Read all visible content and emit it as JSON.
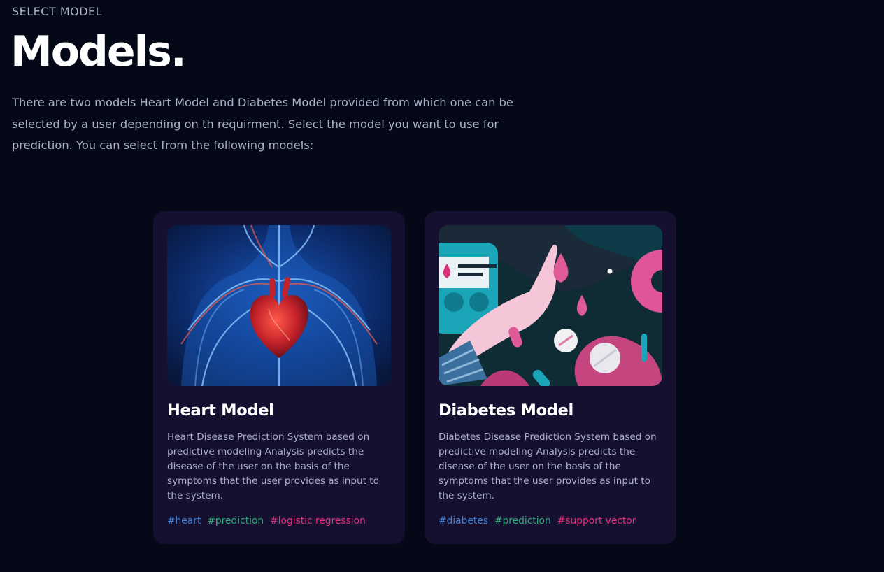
{
  "header": {
    "eyebrow": "SELECT MODEL",
    "title": "Models.",
    "intro": "There are two models Heart Model and Diabetes Model provided from which one can be selected by a user depending on th requirment. Select the model you want to use for prediction. You can select from the following models:"
  },
  "cards": [
    {
      "title": "Heart Model",
      "description": "Heart Disease Prediction System based on predictive modeling Analysis predicts the disease of the user on the basis of the symptoms that the user provides as input to the system.",
      "image": "heart-anatomy-illustration",
      "tags": [
        "#heart",
        "#prediction",
        "#logistic regression"
      ]
    },
    {
      "title": "Diabetes Model",
      "description": "Diabetes Disease Prediction System based on predictive modeling Analysis predicts the disease of the user on the basis of the symptoms that the user provides as input to the system.",
      "image": "diabetes-illustration",
      "tags": [
        "#diabetes",
        "#prediction",
        "#support vector"
      ]
    }
  ],
  "colors": {
    "background": "#050816",
    "card": "#151030",
    "text_secondary": "#aab0c6",
    "tag_blue": "#3b7fd6",
    "tag_green": "#2fa87a",
    "tag_pink": "#e0307a"
  }
}
